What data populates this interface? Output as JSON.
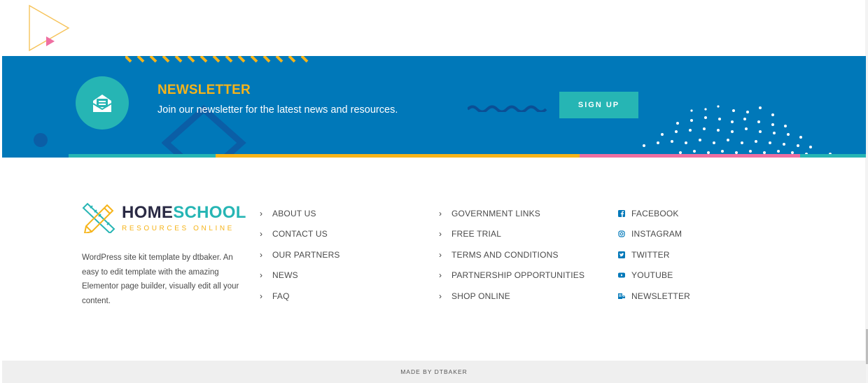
{
  "colors": {
    "banner_blue": "#0078b9",
    "teal": "#26b5b4",
    "yellow": "#f6b41a",
    "pink": "#ef6fa1",
    "dark": "#2a2a44",
    "footer_bg": "#efefef"
  },
  "newsletter": {
    "title": "NEWSLETTER",
    "text": "Join our newsletter for the latest news and resources.",
    "button_label": "SIGN UP",
    "icon": "envelope-icon"
  },
  "brand": {
    "name_part1": "HOME",
    "name_part2": "SCHOOL",
    "subtitle": "RESOURCES ONLINE",
    "description": "WordPress site kit template by dtbaker. An easy to edit template with the amazing Elementor page builder, visually edit all your content."
  },
  "links_col1": [
    "ABOUT US",
    "CONTACT US",
    "OUR PARTNERS",
    "NEWS",
    "FAQ"
  ],
  "links_col2": [
    "GOVERNMENT LINKS",
    "FREE TRIAL",
    "TERMS AND CONDITIONS",
    "PARTNERSHIP OPPORTUNITIES",
    "SHOP ONLINE"
  ],
  "social": [
    {
      "label": "FACEBOOK",
      "icon": "facebook-icon"
    },
    {
      "label": "INSTAGRAM",
      "icon": "instagram-icon"
    },
    {
      "label": "TWITTER",
      "icon": "twitter-icon"
    },
    {
      "label": "YOUTUBE",
      "icon": "youtube-icon"
    },
    {
      "label": "NEWSLETTER",
      "icon": "newsletter-icon"
    }
  ],
  "footer": {
    "credit": "MADE BY DTBAKER"
  }
}
